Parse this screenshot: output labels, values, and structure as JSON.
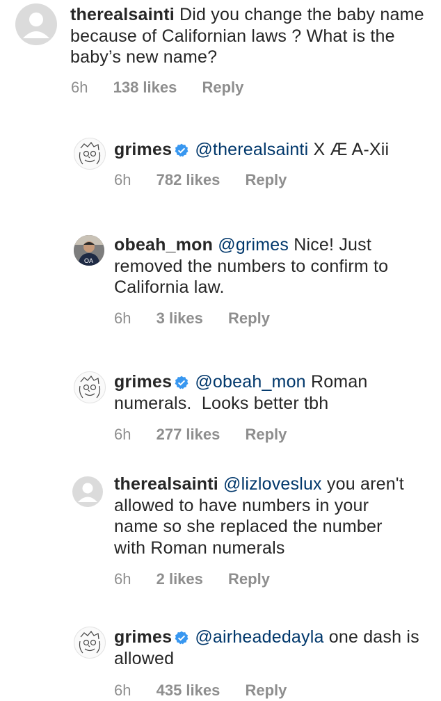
{
  "comments": [
    {
      "username": "therealsainti",
      "avatar": "default-avatar",
      "verified": false,
      "mention": "",
      "body": "Did you change the baby name because of Californian laws ? What is the baby’s new name?",
      "time": "6h",
      "likes": "138 likes",
      "reply": "Reply"
    },
    {
      "username": "grimes",
      "avatar": "grimes-sketch-avatar",
      "verified": true,
      "mention": "@therealsainti",
      "body": "X Æ A-Xii",
      "time": "6h",
      "likes": "782 likes",
      "reply": "Reply"
    },
    {
      "username": "obeah_mon",
      "avatar": "photo-avatar",
      "verified": false,
      "mention": "@grimes",
      "body": "Nice! Just removed the numbers to confirm to California law.",
      "time": "6h",
      "likes": "3 likes",
      "reply": "Reply"
    },
    {
      "username": "grimes",
      "avatar": "grimes-sketch-avatar",
      "verified": true,
      "mention": "@obeah_mon",
      "body": "Roman numerals.  Looks better tbh",
      "time": "6h",
      "likes": "277 likes",
      "reply": "Reply"
    },
    {
      "username": "therealsainti",
      "avatar": "default-avatar",
      "verified": false,
      "mention": "@lizloveslux",
      "body": "you aren't allowed to have numbers in your name so she replaced the number with Roman numerals",
      "time": "6h",
      "likes": "2 likes",
      "reply": "Reply"
    },
    {
      "username": "grimes",
      "avatar": "grimes-sketch-avatar",
      "verified": true,
      "mention": "@airheadedayla",
      "body": "one dash is allowed",
      "time": "6h",
      "likes": "435 likes",
      "reply": "Reply"
    }
  ],
  "colors": {
    "text": "#262626",
    "secondary": "#8e8e8e",
    "verified": "#3897f0",
    "mention": "#00376b",
    "avatar_placeholder": "#dbdbdb"
  }
}
